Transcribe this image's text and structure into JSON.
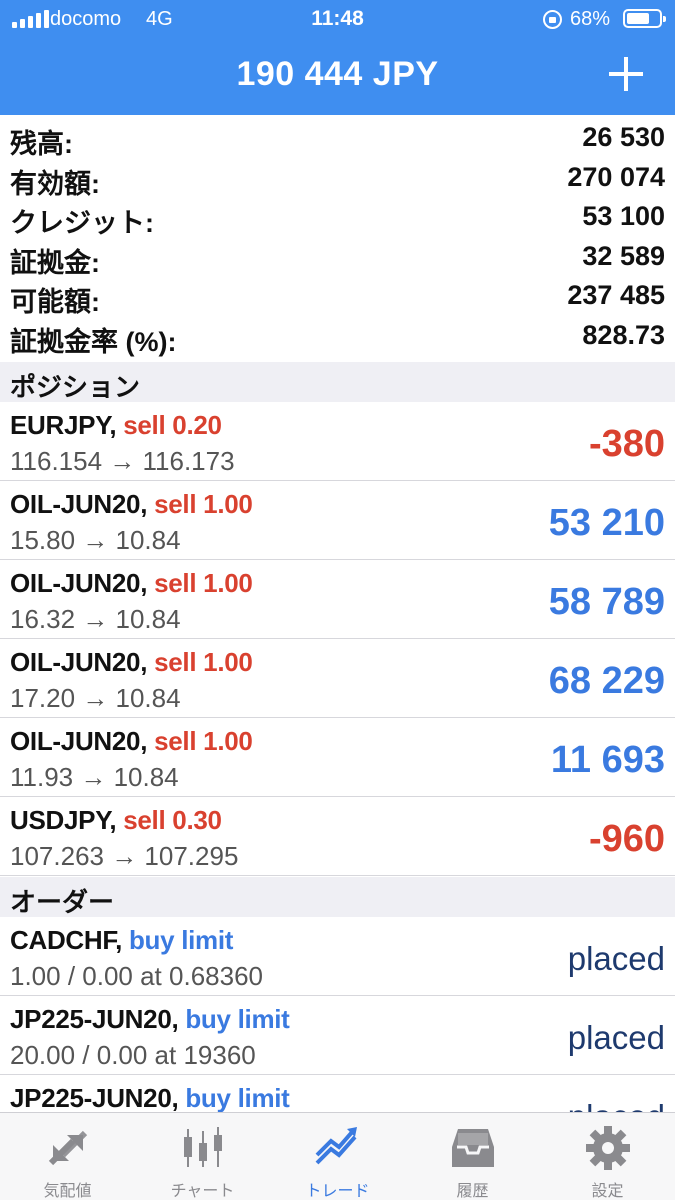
{
  "status_bar": {
    "carrier": "docomo",
    "network": "4G",
    "time": "11:48",
    "battery": "68%",
    "battery_level": 0.68
  },
  "header": {
    "title": "190 444 JPY",
    "add_icon": "plus-icon"
  },
  "summary": [
    {
      "label": "残高:",
      "value": "26 530"
    },
    {
      "label": "有効額:",
      "value": "270 074"
    },
    {
      "label": "クレジット:",
      "value": "53 100"
    },
    {
      "label": "証拠金:",
      "value": "32 589"
    },
    {
      "label": "可能額:",
      "value": "237 485"
    },
    {
      "label": "証拠金率 (%):",
      "value": "828.73"
    }
  ],
  "positions_header": "ポジション",
  "positions": [
    {
      "symbol": "EURJPY,",
      "side": "sell 0.20",
      "prices": "116.154 → 116.173",
      "profit": "-380"
    },
    {
      "symbol": "OIL-JUN20,",
      "side": "sell 1.00",
      "prices": "15.80 → 10.84",
      "profit": "53 210"
    },
    {
      "symbol": "OIL-JUN20,",
      "side": "sell 1.00",
      "prices": "16.32 → 10.84",
      "profit": "58 789"
    },
    {
      "symbol": "OIL-JUN20,",
      "side": "sell 1.00",
      "prices": "17.20 → 10.84",
      "profit": "68 229"
    },
    {
      "symbol": "OIL-JUN20,",
      "side": "sell 1.00",
      "prices": "11.93 → 10.84",
      "profit": "11 693"
    },
    {
      "symbol": "USDJPY,",
      "side": "sell 0.30",
      "prices": "107.263 → 107.295",
      "profit": "-960"
    }
  ],
  "orders_header": "オーダー",
  "orders": [
    {
      "symbol": "CADCHF,",
      "side": "buy limit",
      "detail": "1.00 / 0.00 at 0.68360",
      "state": "placed"
    },
    {
      "symbol": "JP225-JUN20,",
      "side": "buy limit",
      "detail": "20.00 / 0.00 at 19360",
      "state": "placed"
    },
    {
      "symbol": "JP225-JUN20,",
      "side": "buy limit",
      "detail": "",
      "state": "placed"
    }
  ],
  "tabs": [
    {
      "label": "気配値",
      "icon": "quotes-arrows-icon",
      "active": false
    },
    {
      "label": "チャート",
      "icon": "candlestick-icon",
      "active": false
    },
    {
      "label": "トレード",
      "icon": "trade-trend-icon",
      "active": true
    },
    {
      "label": "履歴",
      "icon": "history-inbox-icon",
      "active": false
    },
    {
      "label": "設定",
      "icon": "gear-icon",
      "active": false
    }
  ],
  "colors": {
    "accent": "#3f8ef0",
    "sell": "#d9412f",
    "buy": "#3a7ae0",
    "profit_positive": "#3a7ae0",
    "profit_negative": "#d9412f",
    "inactive_tab": "#8a8a8e"
  }
}
